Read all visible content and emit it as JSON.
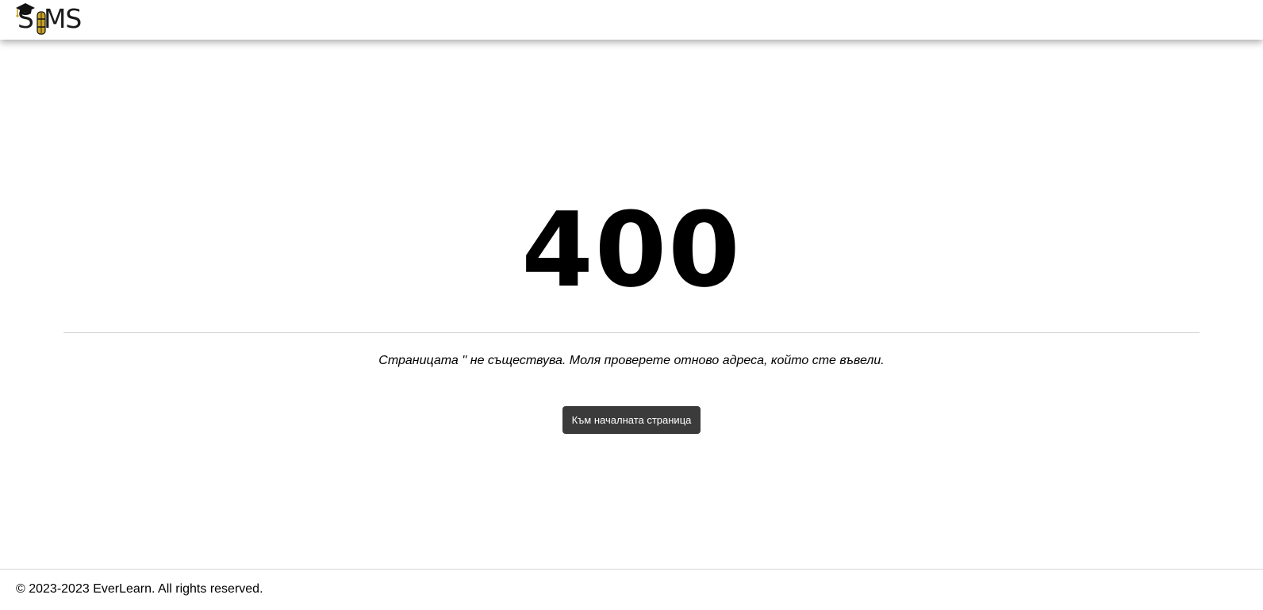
{
  "header": {
    "logo_text": "SIMS",
    "logo_icon": "graduation-cap-icon",
    "brand_color": "#c9a227"
  },
  "error": {
    "code": "400",
    "message": "Страницата '' не съществува. Моля проверете отново адреса, който сте въвели.",
    "home_button_label": "Към началната страница"
  },
  "footer": {
    "copyright": "© 2023-2023 EverLearn. All rights reserved."
  }
}
